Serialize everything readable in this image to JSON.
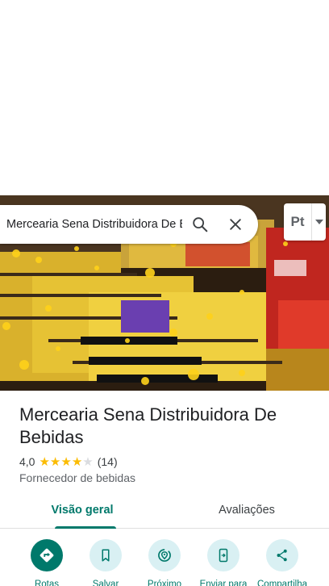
{
  "search": {
    "query": "Mercearia Sena Distribuidora De Bebidas"
  },
  "layers": {
    "label": "Pt"
  },
  "place": {
    "name": "Mercearia Sena Distribuidora De Bebidas",
    "rating": "4,0",
    "rating_fraction": 0.8,
    "review_count": "(14)",
    "category": "Fornecedor de bebidas"
  },
  "tabs": [
    {
      "label": "Visão geral",
      "active": true
    },
    {
      "label": "Avaliações",
      "active": false
    }
  ],
  "actions": [
    {
      "label": "Rotas",
      "icon": "directions-icon"
    },
    {
      "label": "Salvar",
      "icon": "bookmark-icon"
    },
    {
      "label": "Próximo",
      "icon": "nearby-icon"
    },
    {
      "label": "Enviar para",
      "icon": "send-to-phone-icon"
    },
    {
      "label": "Compartilha",
      "icon": "share-icon"
    }
  ],
  "colors": {
    "accent": "#00796b",
    "star": "#fbbc04",
    "star_empty": "#dadce0",
    "action_bg": "#d9f0f3"
  }
}
